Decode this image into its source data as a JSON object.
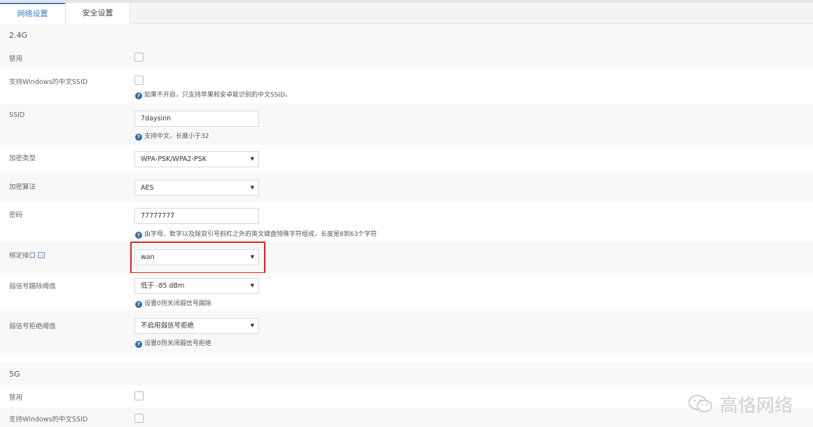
{
  "tabs": [
    {
      "label": "网络设置",
      "active": true
    },
    {
      "label": "安全设置",
      "active": false
    }
  ],
  "band24": {
    "section_title": "2.4G",
    "disable_label": "禁用",
    "chinese_ssid_label": "支持Windows的中文SSID",
    "chinese_ssid_hint": "如果不开启，只支持苹果和安卓能识别的中文SSID。",
    "ssid_label": "SSID",
    "ssid_value": "7daysinn",
    "ssid_hint": "支持中文，长度小于32",
    "encrypt_type_label": "加密类型",
    "encrypt_type_value": "WPA-PSK/WPA2-PSK",
    "encrypt_algo_label": "加密算法",
    "encrypt_algo_value": "AES",
    "password_label": "密码",
    "password_value": "77777777",
    "password_hint": "由字母、数字以及除双引号斜杠之外的英文键盘特殊字符组成，长度是8到63个字符",
    "bind_iface_label": "绑定接口",
    "bind_iface_value": "wan",
    "weak_kick_label": "弱信号踢除阈值",
    "weak_kick_value": "低于 -85 dBm",
    "weak_kick_hint": "设置0则关闭弱信号踢除",
    "weak_reject_label": "弱信号拒绝阈值",
    "weak_reject_value": "不启用弱信号拒绝",
    "weak_reject_hint": "设置0则关闭弱信号拒绝"
  },
  "band5": {
    "section_title": "5G",
    "disable_label": "禁用",
    "chinese_ssid_label": "支持Windows的中文SSID"
  },
  "watermark": {
    "text": "高恪网络"
  },
  "icons": {
    "help": "question-circle-icon",
    "dropdown": "caret-down-icon",
    "info": "info-small-icon"
  },
  "colors": {
    "accent": "#3a7bc8",
    "highlight_box": "#e0201c",
    "help_icon": "#2e6ea8"
  }
}
